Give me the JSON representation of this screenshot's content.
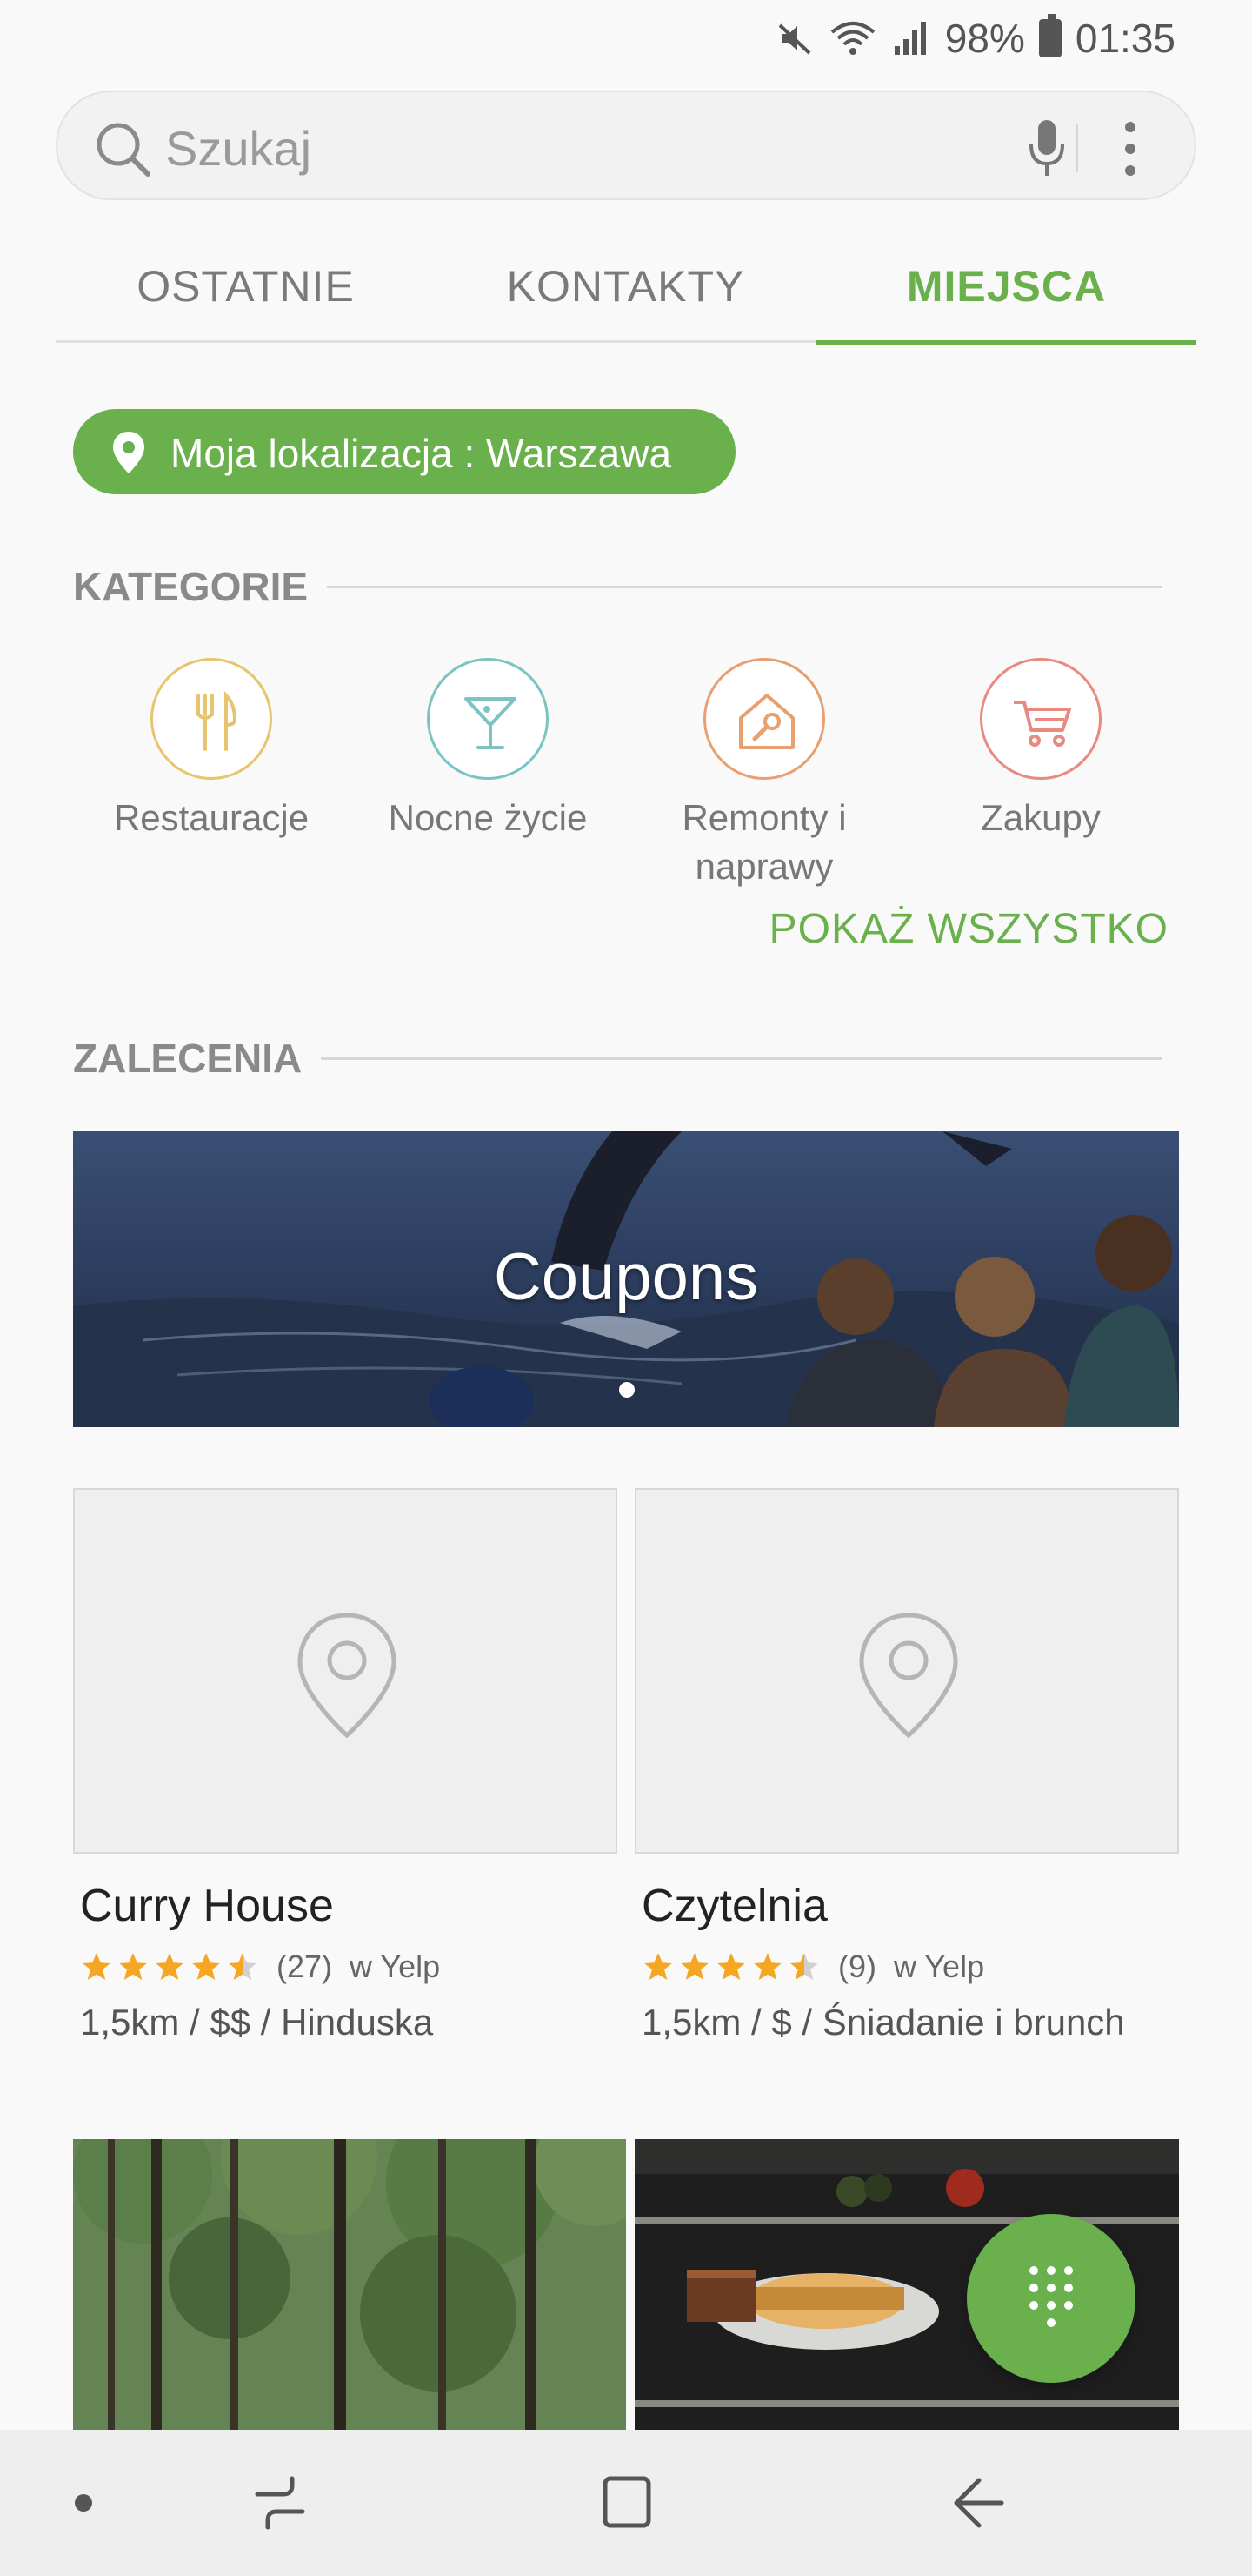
{
  "status_bar": {
    "battery": "98%",
    "time": "01:35",
    "icons": [
      "mute-icon",
      "wifi-icon",
      "signal-icon",
      "battery-icon"
    ]
  },
  "search": {
    "placeholder": "Szukaj",
    "icons": [
      "search-icon",
      "mic-icon",
      "more-vert-icon"
    ]
  },
  "tabs": [
    {
      "label": "OSTATNIE",
      "active": false
    },
    {
      "label": "KONTAKTY",
      "active": false
    },
    {
      "label": "MIEJSCA",
      "active": true
    }
  ],
  "location": {
    "label": "Moja lokalizacja : Warszawa",
    "icon": "location-pin-icon"
  },
  "categories": {
    "title": "KATEGORIE",
    "items": [
      {
        "label": "Restauracje",
        "icon": "fork-knife-icon",
        "color": "#e8c46e"
      },
      {
        "label": "Nocne życie",
        "icon": "cocktail-icon",
        "color": "#7cc4c4"
      },
      {
        "label": "Remonty i naprawy",
        "icon": "house-wrench-icon",
        "color": "#e8a070"
      },
      {
        "label": "Zakupy",
        "icon": "cart-icon",
        "color": "#e88a80"
      }
    ],
    "show_all": "POKAŻ WSZYSTKO"
  },
  "recommendations": {
    "title": "ZALECENIA",
    "banner": {
      "title": "Coupons",
      "pages": 1,
      "current_page": 1
    },
    "places": [
      {
        "name": "Curry House",
        "rating": 4.5,
        "reviews": "(27)",
        "source": "w Yelp",
        "meta": "1,5km / $$ / Hinduska",
        "icon": "place-pin-icon"
      },
      {
        "name": "Czytelnia",
        "rating": 4.5,
        "reviews": "(9)",
        "source": "w Yelp",
        "meta": "1,5km / $ / Śniadanie i brunch",
        "icon": "place-pin-icon"
      }
    ]
  },
  "fab": {
    "icon": "dialpad-icon"
  },
  "nav": {
    "icons": [
      "nav-dot-icon",
      "recent-apps-icon",
      "home-icon",
      "back-icon"
    ]
  },
  "colors": {
    "accent": "#6ab04c",
    "background": "#f9f9f9",
    "star": "#f5a623"
  }
}
